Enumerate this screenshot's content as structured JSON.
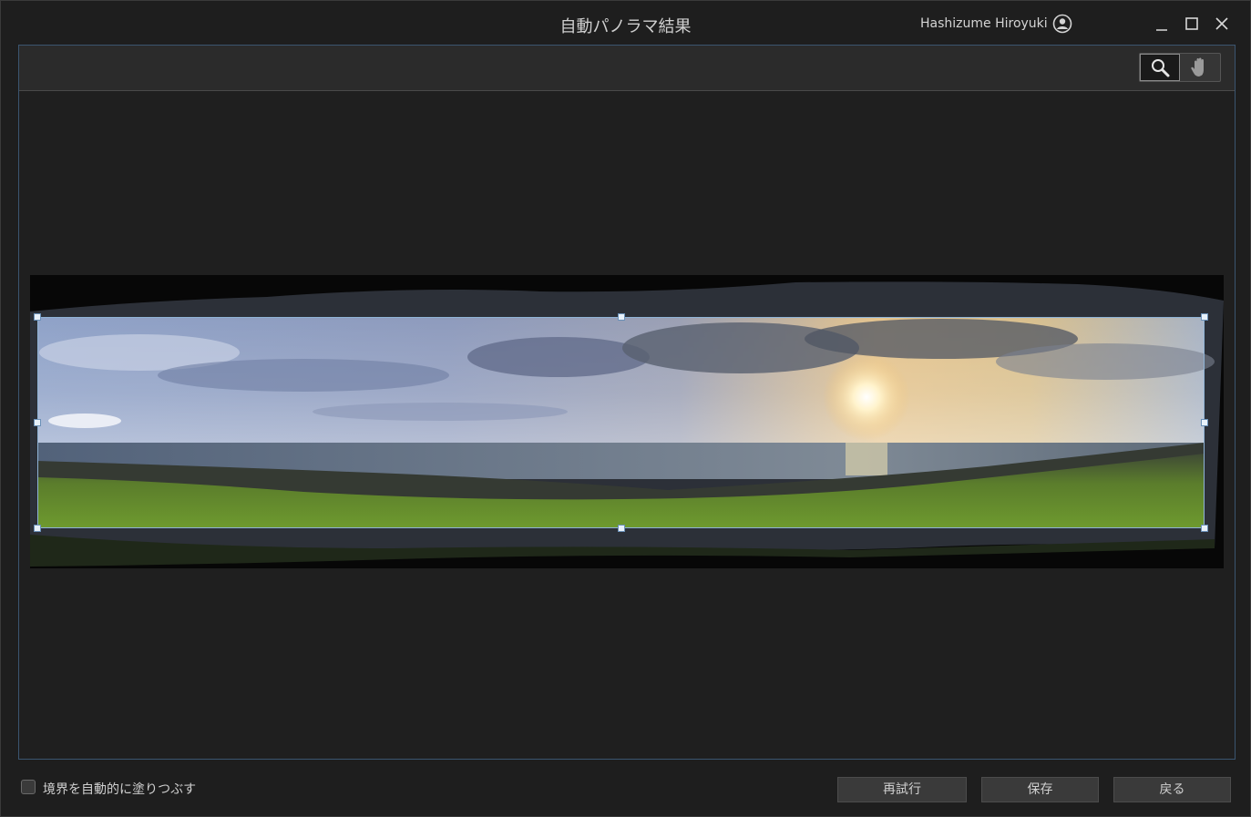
{
  "window": {
    "title": "自動パノラマ結果",
    "user_name": "Hashizume Hiroyuki",
    "icons": [
      "user-account-icon",
      "minimize-icon",
      "maximize-icon",
      "close-icon"
    ]
  },
  "toolbar": {
    "tools": [
      {
        "name": "zoom-tool",
        "icon": "magnifier-icon",
        "active": true
      },
      {
        "name": "pan-tool",
        "icon": "hand-icon",
        "active": false
      }
    ]
  },
  "preview": {
    "image_description_type": "panorama",
    "crop_active": true
  },
  "footer": {
    "auto_fill_label": "境界を自動的に塗りつぶす",
    "auto_fill_checked": false,
    "retry_label": "再試行",
    "save_label": "保存",
    "back_label": "戻る"
  },
  "colors": {
    "accent_border": "#3b5570",
    "crop_border": "#8fb3d6"
  }
}
